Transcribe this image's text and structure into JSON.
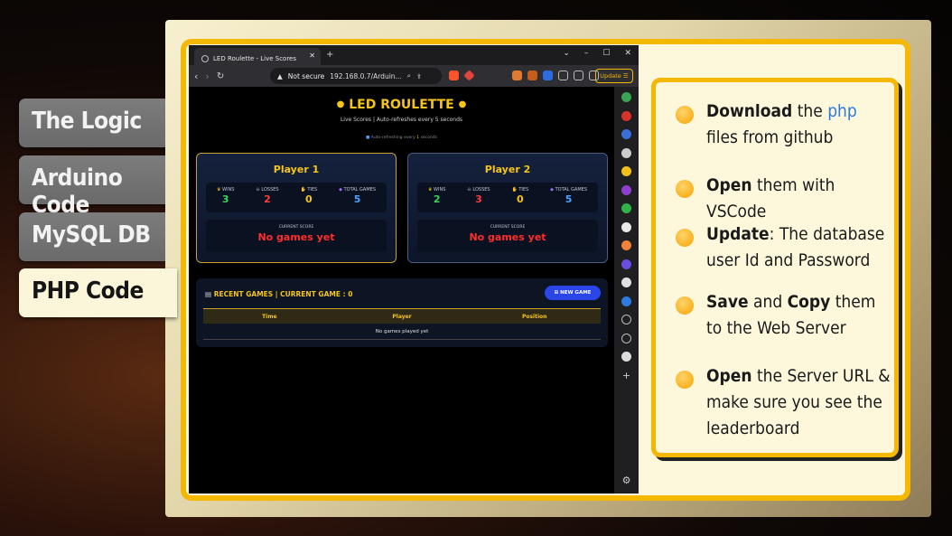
{
  "menu": {
    "items": [
      {
        "label": "The Logic",
        "active": false
      },
      {
        "label": "Arduino Code",
        "active": false
      },
      {
        "label": "MySQL DB",
        "active": false
      },
      {
        "label": "PHP Code",
        "active": true
      }
    ]
  },
  "browser": {
    "tab_title": "LED Roulette - Live Scores",
    "security": "Not secure",
    "url": "192.168.0.7/Arduin...",
    "update_label": "Update"
  },
  "page": {
    "title": "LED ROULETTE",
    "subtitle": "Live Scores | Auto-refreshes every 5 seconds",
    "refresh_prefix": "Auto-refreshing every",
    "refresh_seconds": "1",
    "refresh_suffix": "seconds",
    "players": [
      {
        "name": "Player 1",
        "stats": [
          {
            "label": "WINS",
            "value": "3",
            "color": "#3ed35a"
          },
          {
            "label": "LOSSES",
            "value": "2",
            "color": "#ff3b3b"
          },
          {
            "label": "TIES",
            "value": "0",
            "color": "#f5c518"
          },
          {
            "label": "TOTAL GAMES",
            "value": "5",
            "color": "#4da3ff"
          }
        ],
        "current_score_label": "CURRENT SCORE",
        "current_score": "No games yet"
      },
      {
        "name": "Player 2",
        "stats": [
          {
            "label": "WINS",
            "value": "2",
            "color": "#3ed35a"
          },
          {
            "label": "LOSSES",
            "value": "3",
            "color": "#ff3b3b"
          },
          {
            "label": "TIES",
            "value": "0",
            "color": "#f5c518"
          },
          {
            "label": "TOTAL GAMES",
            "value": "5",
            "color": "#4da3ff"
          }
        ],
        "current_score_label": "CURRENT SCORE",
        "current_score": "No games yet"
      }
    ],
    "recent_title": "RECENT GAMES | CURRENT GAME : 0",
    "new_game_label": "NEW GAME",
    "table_headers": [
      "Time",
      "Player",
      "Position"
    ],
    "table_empty": "No games played yet"
  },
  "notes": [
    {
      "parts": [
        {
          "t": "Download",
          "b": true
        },
        {
          "t": " the "
        },
        {
          "t": "php",
          "blue": true
        },
        {
          "t": " files from github"
        }
      ]
    },
    {
      "parts": [
        {
          "t": "Open",
          "b": true
        },
        {
          "t": " them with VSCode"
        }
      ]
    },
    {
      "parts": [
        {
          "t": "Update",
          "b": true
        },
        {
          "t": ": The database user Id and Password"
        }
      ]
    },
    {
      "parts": [
        {
          "t": "Save",
          "b": true
        },
        {
          "t": " and "
        },
        {
          "t": "Copy",
          "b": true
        },
        {
          "t": " them to  the Web Server"
        }
      ]
    },
    {
      "parts": [
        {
          "t": "Open",
          "b": true
        },
        {
          "t": " the Server URL & make sure you see the leaderboard"
        }
      ]
    }
  ]
}
